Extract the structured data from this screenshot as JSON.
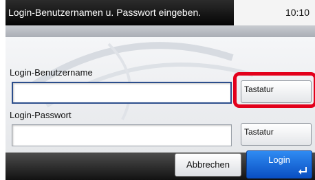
{
  "header": {
    "title": "Login-Benutzernamen u. Passwort eingeben.",
    "time": "10:10"
  },
  "form": {
    "username_label": "Login-Benutzername",
    "username_value": "",
    "password_label": "Login-Passwort",
    "password_value": "",
    "keyboard_button_label": "Tastatur"
  },
  "footer": {
    "cancel_label": "Abbrechen",
    "login_label": "Login"
  },
  "colors": {
    "highlight": "#e3001b",
    "login_blue": "#1a6ee0",
    "focus_border": "#2c4e8c"
  },
  "icons": {
    "login_button_icon": "enter-icon"
  }
}
